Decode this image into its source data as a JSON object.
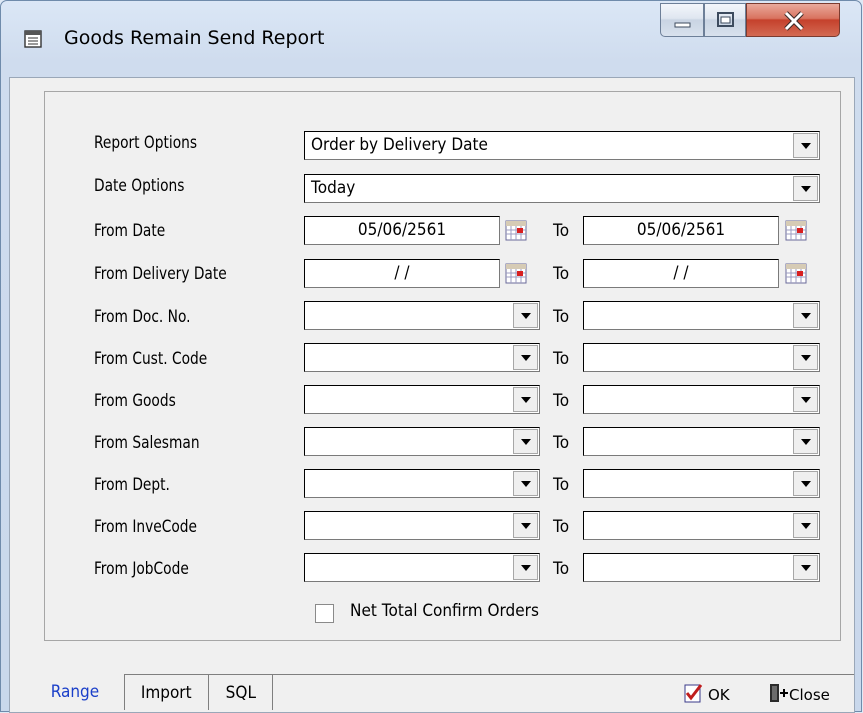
{
  "window": {
    "title": "Goods Remain Send Report"
  },
  "form": {
    "report_options": {
      "label": "Report Options",
      "value": "Order by Delivery Date"
    },
    "date_options": {
      "label": "Date Options",
      "value": "Today"
    },
    "from_date": {
      "label": "From Date",
      "from": "05/06/2561",
      "to": "05/06/2561"
    },
    "from_delivery_date": {
      "label": "From Delivery Date",
      "from": " /  / ",
      "to": " /  / "
    },
    "to_label": "To",
    "ranges": [
      {
        "label": "From Doc. No.",
        "from": "",
        "to": ""
      },
      {
        "label": "From Cust. Code",
        "from": "",
        "to": ""
      },
      {
        "label": "From Goods",
        "from": "",
        "to": ""
      },
      {
        "label": "From Salesman",
        "from": "",
        "to": ""
      },
      {
        "label": "From Dept.",
        "from": "",
        "to": ""
      },
      {
        "label": "From InveCode",
        "from": "",
        "to": ""
      },
      {
        "label": "From JobCode",
        "from": "",
        "to": ""
      }
    ],
    "net_total_confirm": {
      "label": "Net Total Confirm Orders",
      "checked": false
    }
  },
  "tabs": [
    {
      "label": "Range",
      "active": true
    },
    {
      "label": "Import",
      "active": false
    },
    {
      "label": "SQL",
      "active": false
    }
  ],
  "buttons": {
    "ok": "OK",
    "close": "Close"
  },
  "colors": {
    "active_tab_text": "#1a3fc9",
    "close_button": "#c5412c"
  }
}
